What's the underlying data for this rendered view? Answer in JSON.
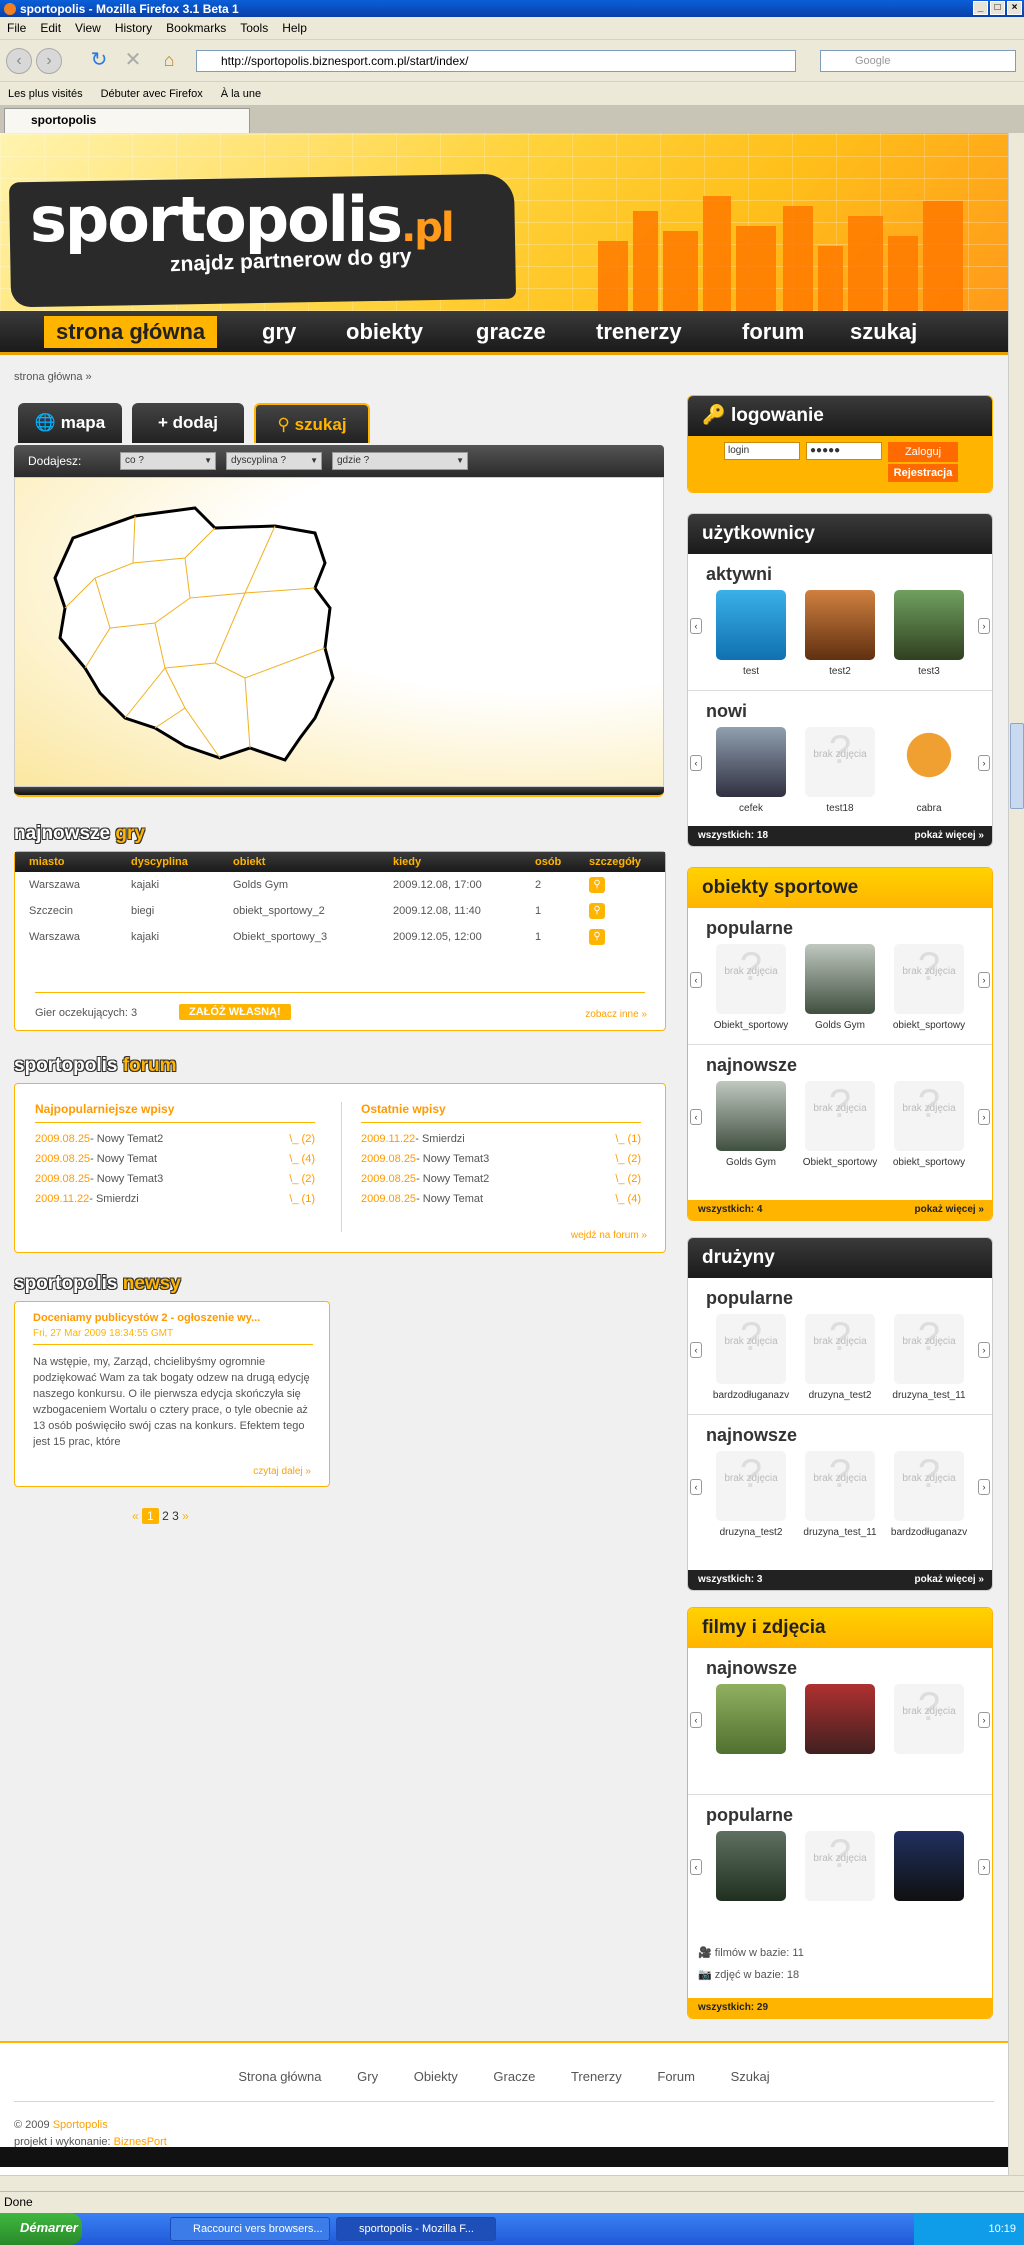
{
  "browser": {
    "title": "sportopolis - Mozilla Firefox 3.1 Beta 1",
    "menu": [
      "File",
      "Edit",
      "View",
      "History",
      "Bookmarks",
      "Tools",
      "Help"
    ],
    "url": "http://sportopolis.biznesport.com.pl/start/index/",
    "search_placeholder": "Google",
    "bookmarks": [
      "Les plus visités",
      "Débuter avec Firefox",
      "À la une"
    ],
    "tab": "sportopolis",
    "status": "Done"
  },
  "taskbar": {
    "start": "Démarrer",
    "items": [
      "Raccourci vers browsers...",
      "sportopolis - Mozilla F..."
    ],
    "clock": "10:19"
  },
  "site": {
    "logo": "sportopolis",
    "logo_pl": ".pl",
    "tagline": "znajdz partnerow do gry",
    "nav": [
      "strona główna",
      "gry",
      "obiekty",
      "gracze",
      "trenerzy",
      "forum",
      "szukaj"
    ],
    "breadcrumb": "strona główna »",
    "tabs": [
      "mapa",
      "+ dodaj",
      "szukaj"
    ],
    "add_label": "Dodajesz:",
    "selects": [
      "co ?",
      "dyscyplina ?",
      "gdzie ?"
    ],
    "games_title": [
      "najnowsze",
      "gry"
    ],
    "games_headers": [
      "miasto",
      "dyscyplina",
      "obiekt",
      "kiedy",
      "osób",
      "szczegóły"
    ],
    "games_rows": [
      [
        "Warszawa",
        "kajaki",
        "Golds Gym",
        "2009.12.08, 17:00",
        "2"
      ],
      [
        "Szczecin",
        "biegi",
        "obiekt_sportowy_2",
        "2009.12.08, 11:40",
        "1"
      ],
      [
        "Warszawa",
        "kajaki",
        "Obiekt_sportowy_3",
        "2009.12.05, 12:00",
        "1"
      ]
    ],
    "games_waiting": "Gier oczekujących: 3",
    "games_create": "ZAŁÓŻ WŁASNĄ!",
    "games_more": "zobacz inne »",
    "forum_title": [
      "sportopolis",
      "forum"
    ],
    "forum_pop_title": "Najpopularniejsze wpisy",
    "forum_pop": [
      [
        "2009.08.25",
        " - Nowy Temat2",
        "\\_ (2)"
      ],
      [
        "2009.08.25",
        " - Nowy Temat",
        "\\_ (4)"
      ],
      [
        "2009.08.25",
        " - Nowy Temat3",
        "\\_ (2)"
      ],
      [
        "2009.11.22",
        " - Smierdzi",
        "\\_ (1)"
      ]
    ],
    "forum_last_title": "Ostatnie wpisy",
    "forum_last": [
      [
        "2009.11.22",
        " - Smierdzi",
        "\\_ (1)"
      ],
      [
        "2009.08.25",
        " - Nowy Temat3",
        "\\_ (2)"
      ],
      [
        "2009.08.25",
        " - Nowy Temat2",
        "\\_ (2)"
      ],
      [
        "2009.08.25",
        " - Nowy Temat",
        "\\_ (4)"
      ]
    ],
    "forum_more": "wejdź na forum »",
    "news_title": [
      "sportopolis",
      "newsy"
    ],
    "news_headline": "Doceniamy publicystów 2 - ogłoszenie wy...",
    "news_date": "Fri, 27 Mar 2009 18:34:55 GMT",
    "news_body": "Na wstępie, my, Zarząd, chcielibyśmy ogromnie podziękować Wam za tak bogaty odzew na drugą edycję naszego konkursu. O ile pierwsza edycja skończyła się wzbogaceniem Wortalu o cztery prace, o tyle obecnie aż 13 osób poświęciło swój czas na konkurs. Efektem tego jest 15 prac, które",
    "news_more": "czytaj dalej »",
    "pages": [
      "«",
      "1",
      "2",
      "3",
      "»"
    ],
    "login": {
      "title": "logowanie",
      "login": "login",
      "password": "●●●●●",
      "submit": "Zaloguj",
      "register": "Rejestracja"
    },
    "users": {
      "title": "użytkownicy",
      "active": "aktywni",
      "active_names": [
        "test",
        "test2",
        "test3"
      ],
      "new": "nowi",
      "new_names": [
        "cefek",
        "test18",
        "cabra"
      ],
      "count": "wszystkich: 18",
      "more": "pokaż więcej »"
    },
    "objects": {
      "title": "obiekty sportowe",
      "popular": "popularne",
      "popular_names": [
        "Obiekt_sportowy",
        "Golds Gym",
        "obiekt_sportowy"
      ],
      "newest": "najnowsze",
      "newest_names": [
        "Golds Gym",
        "Obiekt_sportowy",
        "obiekt_sportowy"
      ],
      "count": "wszystkich: 4",
      "more": "pokaż więcej »"
    },
    "teams": {
      "title": "drużyny",
      "popular": "popularne",
      "popular_names": [
        "bardzodługanazv",
        "druzyna_test2",
        "druzyna_test_11"
      ],
      "newest": "najnowsze",
      "newest_names": [
        "druzyna_test2",
        "druzyna_test_11",
        "bardzodługanazv"
      ],
      "count": "wszystkich: 3",
      "more": "pokaż więcej »"
    },
    "media": {
      "title": "filmy i zdjęcia",
      "newest": "najnowsze",
      "popular": "popularne",
      "films": "filmów w bazie: 11",
      "photos": "zdjęć w bazie: 18",
      "count": "wszystkich: 29"
    },
    "no_photo": "brak zdjęcia",
    "footer_nav": [
      "Strona główna",
      "Gry",
      "Obiekty",
      "Gracze",
      "Trenerzy",
      "Forum",
      "Szukaj"
    ],
    "copyright": "© 2009 ",
    "copyright_link": "Sportopolis",
    "made_by": "projekt i wykonanie: ",
    "made_by_link": "BiznesPort"
  }
}
